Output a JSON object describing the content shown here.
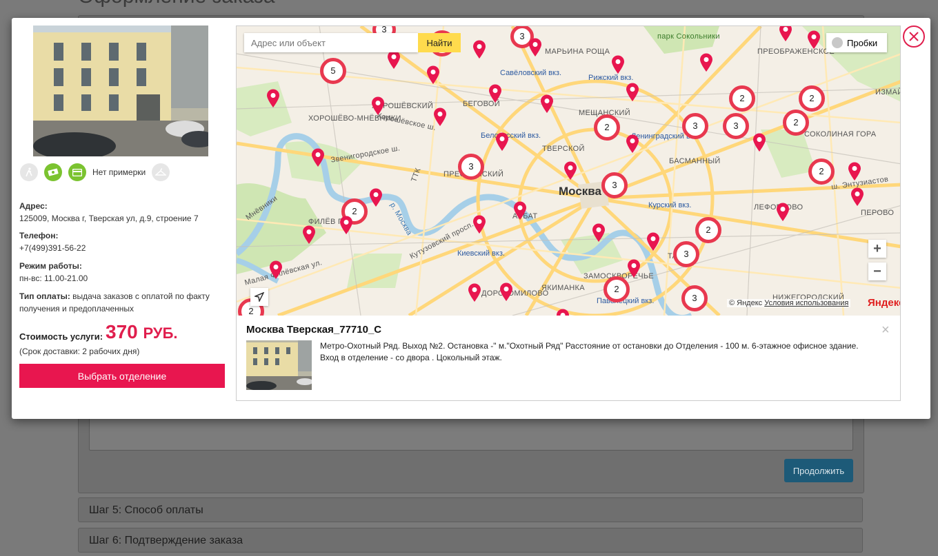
{
  "background": {
    "page_title": "Оформление заказа",
    "continue_button": "Продолжить",
    "step5": "Шаг 5: Способ оплаты",
    "step6": "Шаг 6: Подтверждение заказа"
  },
  "modal": {
    "features": {
      "no_fitting": "Нет примерки"
    },
    "address_label": "Адрес:",
    "address_value": "125009, Москва г, Тверская ул, д.9, строение 7",
    "phone_label": "Телефон:",
    "phone_value": "+7(499)391-56-22",
    "hours_label": "Режим работы:",
    "hours_value": "пн-вс: 11.00-21.00",
    "payment_label": "Тип оплаты:",
    "payment_value": "выдача заказов с оплатой по факту получения и предоплаченных",
    "price_label": "Стоимость услуги:",
    "price_value": "370",
    "price_currency": "РУБ.",
    "delivery_term": "(Срок доставки: 2 рабочих дня)",
    "select_button": "Выбрать отделение",
    "close": "⊗"
  },
  "map": {
    "search_placeholder": "Адрес или объект",
    "search_button": "Найти",
    "traffic_button": "Пробки",
    "zoom_in": "+",
    "zoom_out": "−",
    "attribution": "© Яндекс",
    "terms_link": "Условия использования",
    "yandex_logo": "Яндекс",
    "labels": {
      "moscow": "Москва",
      "sokolniki": "парк Сокольники",
      "maryina": "МАРЬИНА РОЩА",
      "preobr": "ПРЕОБРАЖЕНСКОЕ",
      "savelovsky": "Савёловский вкз.",
      "rizhsky": "Рижский вкз.",
      "khoroshevsky": "ХОРОШЁВСКИЙ",
      "khoroshevo": "ХОРОШЁВО-МНЁВНИКИ",
      "begovoy": "БЕГОВОЙ",
      "meshchansky": "МЕЩАНСКИЙ",
      "leningradsky": "Ленинградский вкз.",
      "belorussky": "Белорусский вкз.",
      "tverskoy": "ТВЕРСКОЙ",
      "basmanny": "БАСМАННЫЙ",
      "sokolinaya": "СОКОЛИНАЯ ГОРА",
      "izmailovo": "ИЗМАЙ",
      "kursky": "Курский вкз.",
      "lefortovo": "ЛЕФОРТОВО",
      "perovo": "ПЕРОВО",
      "arbat": "АРБАТ",
      "fili": "ФИЛЁВ ПАРК",
      "kievsky": "Киевский вкз.",
      "zamoskvorechye": "ЗАМОСКВОРЕЧЬЕ",
      "paveletsky": "Павелецкий вкз.",
      "yakimanka": "ЯКИМАНКА",
      "nizhegorodsky": "НИЖЕГОРОДСКИЙ",
      "dorogomilovo": "ДОРОГОМИЛОВО",
      "taganka": "ТАГ",
      "zvenigorodskoe": "Звенигородское ш.",
      "khoroshevskoe": "Хорошёвское ш.",
      "kutuzovsky": "Кутузовский просп.",
      "entuziastov": "ш. Энтузиастов",
      "presnensky": "ПРЕСНЕНСКИЙ",
      "ttk": "ТТК",
      "moskva_river": "р. Москва",
      "mnevniki": "Мнёвники",
      "malaya": "Малая Филёвская ул."
    },
    "clusters": [
      "3",
      "3",
      "5",
      "2",
      "2",
      "3",
      "3",
      "3",
      "2",
      "2",
      "2",
      "3",
      "2",
      "2",
      "3",
      "3",
      "2",
      "2",
      "2"
    ]
  },
  "popup": {
    "title": "Москва Тверская_77710_С",
    "description": "Метро-Охотный Ряд. Выход №2. Остановка -\" м.\"Охотный Ряд\" Расстояние от остановки до Отделения - 100 м. 6-этажное офисное здание. Вход в отделение - со двора . Цокольный этаж.",
    "close": "×"
  }
}
